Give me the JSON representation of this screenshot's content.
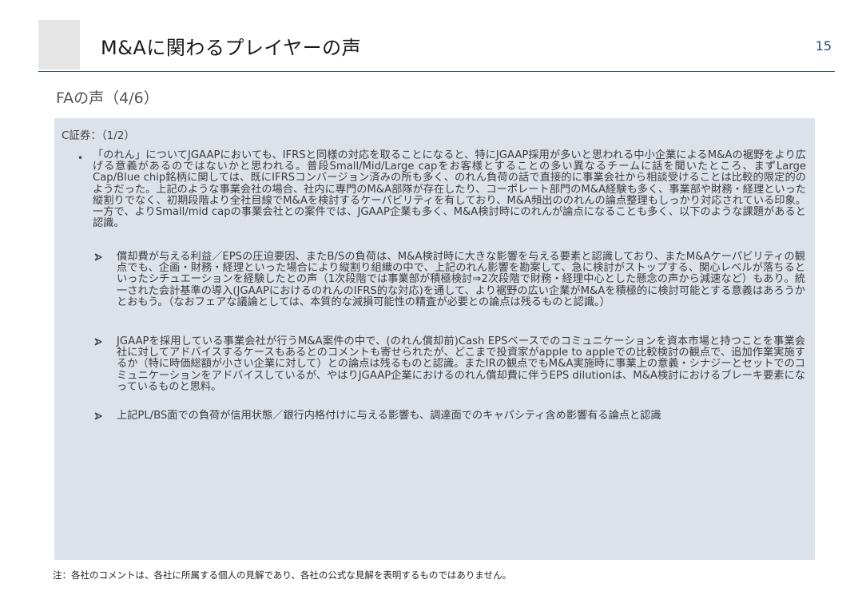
{
  "header": {
    "title": "M&Aに関わるプレイヤーの声",
    "page_number": "15"
  },
  "subtitle": "FAの声（4/6）",
  "panel": {
    "heading": "C証券：（1/2）",
    "bullet_marker": "•",
    "bullet_text": "「のれん」についてJGAAPにおいても、IFRSと同様の対応を取ることになると、特にJGAAP採用が多いと思われる中小企業によるM&Aの裾野をより広げる意義があるのではないかと思われる。普段Small/Mid/Large capをお客様とすることの多い異なるチームに話を聞いたところ、まずLarge Cap/Blue chip銘柄に関しては、既にIFRSコンバージョン済みの所も多く、のれん負荷の話で直接的に事業会社から相談受けることは比較的限定的のようだった。上記のような事業会社の場合、社内に専門のM&A部隊が存在したり、コーポレート部門のM&A経験も多く、事業部や財務・経理といった縦割りでなく、初期段階より全社目線でM&Aを検討するケーパビリティを有しており、M&A頻出ののれんの論点整理もしっかり対応されている印象。一方で、よりSmall/mid capの事業会社との案件では、JGAAP企業も多く、M&A検討時にのれんが論点になることも多く、以下のような課題があると認識。",
    "sub_items": [
      {
        "icon": "arrow-bullet-icon",
        "text": "償却費が与える利益／EPSの圧迫要因、またB/Sの負荷は、M&A検討時に大きな影響を与える要素と認識しており、またM&Aケーパビリティの観点でも、企画・財務・経理といった場合により縦割り組織の中で、上記のれん影響を勘案して、急に検討がストップする、関心レベルが落ちるといったシチュエーションを経験したとの声（1次段階では事業部が積極検討⇒2次段階で財務・経理中心とした懸念の声から減速など）もあり。統一された会計基準の導入(JGAAPにおけるのれんのIFRS的な対応)を通して、より裾野の広い企業がM&Aを積極的に検討可能とする意義はあろうかとおもう。（なおフェアな議論としては、本質的な減損可能性の精査が必要との論点は残るものと認識。）"
      },
      {
        "icon": "arrow-bullet-icon",
        "text": "JGAAPを採用している事業会社が行うM&A案件の中で、(のれん償却前)Cash EPSベースでのコミュニケーションを資本市場と持つことを事業会社に対してアドバイスするケースもあるとのコメントも寄せられたが、どこまで投資家がapple to appleでの比較検討の観点で、追加作業実施するか（特に時価総額が小さい企業に対して）との論点は残るものと認識。またIRの観点でもM&A実施時に事業上の意義・シナジーとセットでのコミュニケーションをアドバイスしているが、やはりJGAAP企業におけるのれん償却費に伴うEPS dilutionは、M&A検討におけるブレーキ要素になっているものと思料。"
      },
      {
        "icon": "arrow-bullet-icon",
        "text": "上記PL/BS面での負荷が信用状態／銀行内格付けに与える影響も、調達面でのキャパシティ含め影響有る論点と認識"
      }
    ]
  },
  "footnote": "注：各社のコメントは、各社に所属する個人の見解であり、各社の公式な見解を表明するものではありません。",
  "colors": {
    "panel_background": "#dde1ea",
    "title_rule": "#3a5468",
    "page_number": "#1f4e79",
    "accent_box": "#e6e6e6"
  }
}
